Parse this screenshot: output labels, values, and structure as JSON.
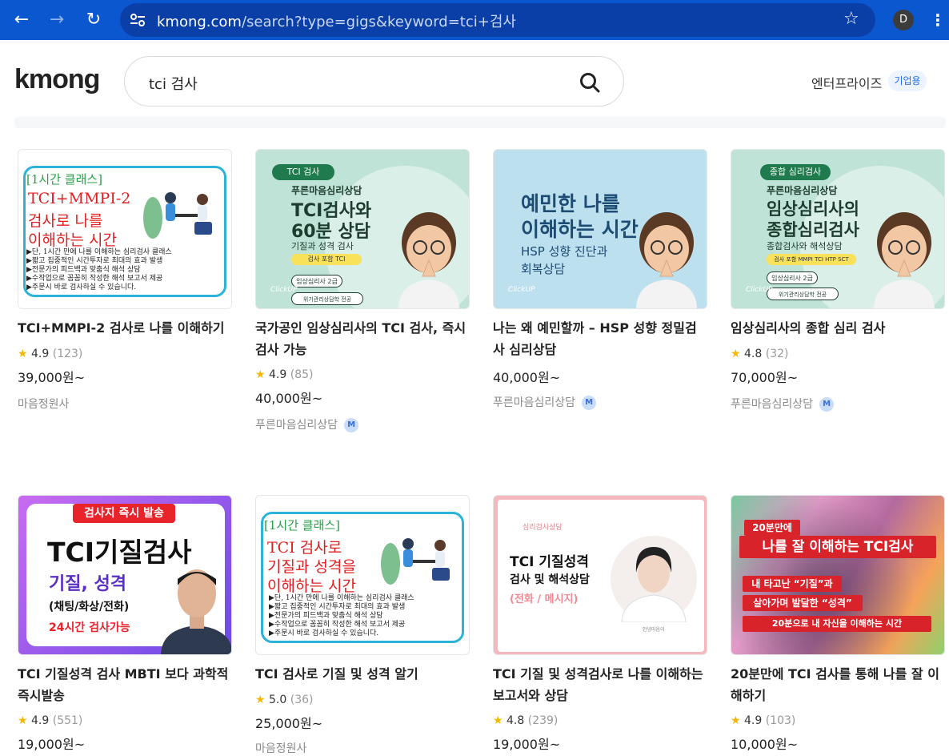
{
  "browser": {
    "url_host": "kmong.com",
    "url_path": "/search?type=gigs&keyword=tci+검사",
    "profile_initial": "D"
  },
  "header": {
    "logo": "kmong",
    "search_value": "tci 검사",
    "enterprise_label": "엔터프라이즈",
    "enterprise_badge": "기업용"
  },
  "gigs": [
    {
      "title": "TCI+MMPI-2 검사로 나를 이해하기",
      "rating": "4.9",
      "reviews": "(123)",
      "price": "39,000원~",
      "seller": "마음정원사",
      "thumb": {
        "tag": "[1시간 클래스]",
        "h1": "TCI+MMPI-2",
        "h2": "검사로 나를",
        "h3": "이해하는 시간",
        "bullets": [
          "▶단, 1시간 만에 나를 이해하는 심리검사 클래스",
          "▶짧고 집중적인 시간투자로 최대의 효과 발생",
          "▶전문가의 피드백과 맞춤식 해석 상담",
          "▶수작업으로 꼼꼼히 작성한 해석 보고서 제공",
          "▶주문시 바로 검사하실 수 있습니다."
        ]
      }
    },
    {
      "title": "국가공인 임상심리사의 TCI 검사, 즉시 검사 가능",
      "rating": "4.9",
      "reviews": "(85)",
      "price": "40,000원~",
      "seller": "푸른마음심리상담",
      "thumb": {
        "tag": "TCI 검사",
        "sub": "푸른마음심리상담",
        "h1": "TCI검사와",
        "h2": "60분 상담",
        "desc": "기질과 성격 검사",
        "chip": "검사 포함   TCI",
        "p1": "임상심리사 2급",
        "p2": "위기관리상담학 전공",
        "brand": "ClickUP"
      }
    },
    {
      "title": "나는 왜 예민할까 – HSP 성향 정밀검사 심리상담",
      "rating": "",
      "reviews": "",
      "price": "40,000원~",
      "seller": "푸른마음심리상담",
      "thumb": {
        "h1": "예민한 나를",
        "h2": "이해하는 시간",
        "h3": "HSP 성향 진단과",
        "h4": "회복상담",
        "brand": "ClickUP"
      }
    },
    {
      "title": "임상심리사의 종합 심리 검사",
      "rating": "4.8",
      "reviews": "(32)",
      "price": "70,000원~",
      "seller": "푸른마음심리상담",
      "thumb": {
        "tag": "종합 심리검사",
        "sub": "푸른마음심리상담",
        "h1": "임상심리사의",
        "h2": "종합심리검사",
        "desc": "종합검사와 해석상담",
        "chip": "검사 포함   MMPI TCI HTP SCT",
        "p1": "임상심리사 2급",
        "p2": "위기관리상담학 전공",
        "brand": "ClickUP"
      }
    },
    {
      "title": "TCI 기질성격 검사 MBTI 보다 과학적 즉시발송",
      "rating": "4.9",
      "reviews": "(551)",
      "price": "19,000원~",
      "seller": "",
      "thumb": {
        "tag": "검사지 즉시 발송",
        "h1": "TCI기질검사",
        "h2": "기질, 성격",
        "h3": "(채팅/화상/전화)",
        "h4": "24시간 검사가능"
      }
    },
    {
      "title": "TCI 검사로 기질 및 성격 알기",
      "rating": "5.0",
      "reviews": "(36)",
      "price": "25,000원~",
      "seller": "마음정원사",
      "thumb": {
        "tag": "[1시간 클래스]",
        "h1": "TCI 검사로",
        "h2": "기질과 성격을",
        "h3": "이해하는 시간",
        "bullets": [
          "▶단, 1시간 만에 나를 이해하는 심리검사 클래스",
          "▶짧고 집중적인 시간투자로 최대의 효과 발생",
          "▶전문가의 피드백과 맞춤식 해석 상담",
          "▶수작업으로 꼼꼼히 작성한 해석 보고서 제공",
          "▶주문시 바로 검사하실 수 있습니다."
        ]
      }
    },
    {
      "title": "TCI 기질 및 성격검사로 나를 이해하는 보고서와 상담",
      "rating": "4.8",
      "reviews": "(239)",
      "price": "19,000원~",
      "seller": "",
      "thumb": {
        "tag": "심리검사상담",
        "h1": "TCI 기질성격",
        "h2": "검사 및 해석상담",
        "h3": "(전화 / 메시지)",
        "caption": "안녕마음이"
      }
    },
    {
      "title": "20분만에 TCI 검사를 통해 나를 잘 이해하기",
      "rating": "4.9",
      "reviews": "(103)",
      "price": "10,000원~",
      "seller": "",
      "thumb": {
        "tag": "20분만에",
        "h1": "나를 잘 이해하는 TCI검사",
        "h2": "내 타고난 “기질”과",
        "h3": "살아가며 발달한 “성격”",
        "h4": "20분으로 내 자신을 이해하는 시간"
      }
    }
  ],
  "icons": {
    "back": "arrow-left-icon",
    "forward": "arrow-right-icon",
    "reload": "reload-icon",
    "tune": "site-info-icon",
    "bookmark": "star-icon",
    "search": "search-icon",
    "menu": "kebab-menu-icon",
    "rating": "star-icon"
  },
  "colors": {
    "chrome": "#0b57d0",
    "accent": "#1a6cf0",
    "star": "#f5b800"
  }
}
